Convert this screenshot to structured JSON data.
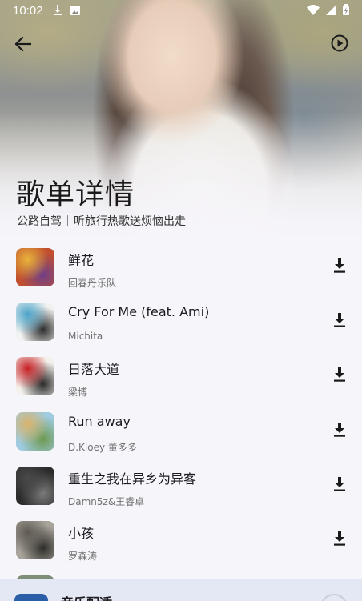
{
  "status_bar": {
    "time": "10:02",
    "left_icons": [
      "download-icon",
      "image-icon"
    ],
    "right_icons": [
      "wifi-icon",
      "signal-icon",
      "battery-icon"
    ]
  },
  "app_bar": {
    "back_icon": "arrow-left-icon",
    "play_icon": "play-circle-icon"
  },
  "header": {
    "title": "歌单详情",
    "playlist_name": "公路自驾",
    "playlist_desc": "听旅行热歌送烦恼出走"
  },
  "songs": [
    {
      "title": "鲜花",
      "artist": "回春丹乐队",
      "cover_colors": [
        "#c2502f",
        "#e8b43a",
        "#6f3f88"
      ]
    },
    {
      "title": "Cry For Me (feat. Ami)",
      "artist": "Michita",
      "cover_colors": [
        "#f2f2f0",
        "#4aa3c9",
        "#2d2d2d"
      ]
    },
    {
      "title": "日落大道",
      "artist": "梁博",
      "cover_colors": [
        "#f4f1ec",
        "#c71f24",
        "#2a2a2a"
      ]
    },
    {
      "title": "Run away",
      "artist": "D.Kloey 董多多",
      "cover_colors": [
        "#9fcbe0",
        "#d9b36a",
        "#6d9a52"
      ]
    },
    {
      "title": "重生之我在异乡为异客",
      "artist": "Damn5z&王睿卓",
      "cover_colors": [
        "#2b2b2b",
        "#4a4a4a",
        "#7a7a7a"
      ]
    },
    {
      "title": "小孩",
      "artist": "罗森涛",
      "cover_colors": [
        "#a8a49c",
        "#5e5a53",
        "#2e2c29"
      ]
    }
  ],
  "download_icon": "download-icon",
  "mini_player": {
    "title": "音乐配适",
    "accent": "#2a5fa8"
  }
}
